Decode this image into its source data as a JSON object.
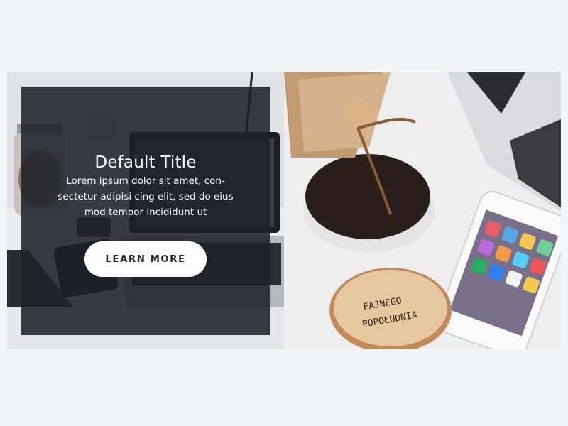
{
  "hero": {
    "title": "Default Title",
    "body": "Lorem ipsum dolor sit amet, con-sectetur adipisi cing elit, sed do eius mod tempor incididunt ut",
    "cta_label": "LEARN MORE",
    "coaster_text_line1": "FAJNEGO",
    "coaster_text_line2": "POPOŁUDNIA"
  },
  "colors": {
    "page_background": "#f0f4f7",
    "overlay": "#1e212a",
    "button_background": "#ffffff",
    "button_text": "#2a2d35"
  }
}
